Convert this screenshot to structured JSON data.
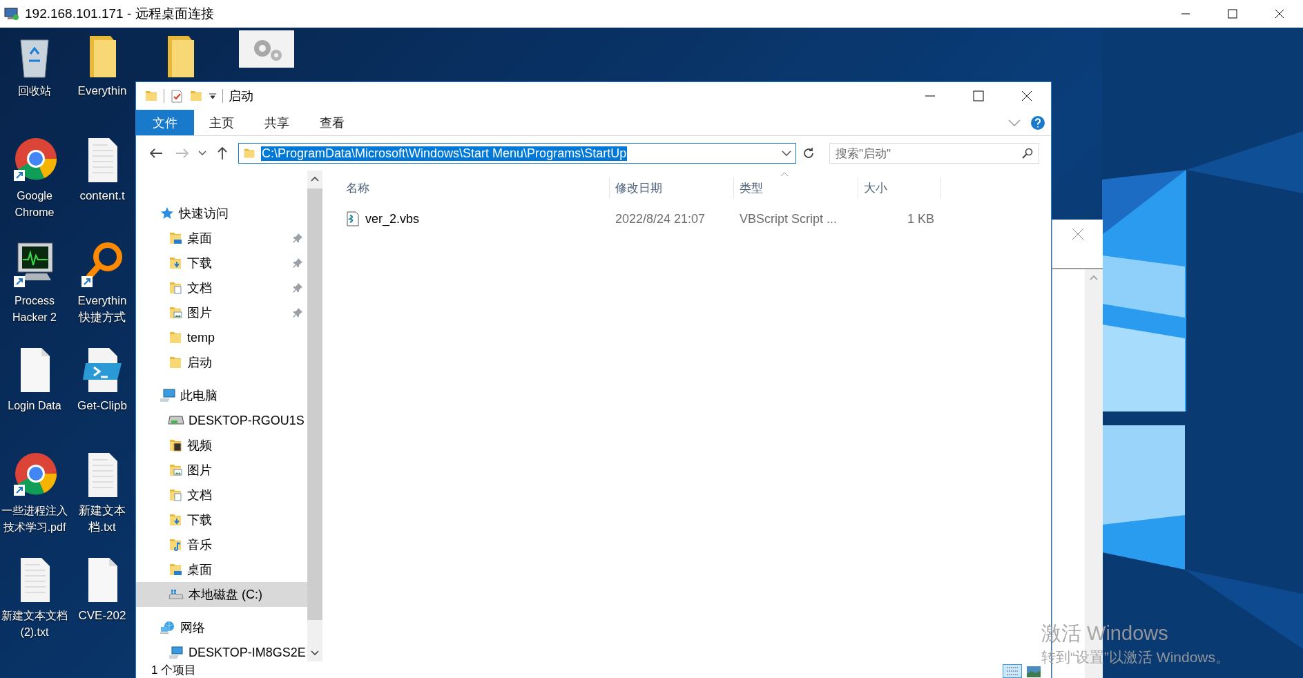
{
  "rdp_window": {
    "title": "192.168.101.171 - 远程桌面连接"
  },
  "desktop": {
    "columns": [
      [
        {
          "label": "回收站",
          "kind": "recycle-bin"
        },
        {
          "label": "Google Chrome",
          "kind": "browser"
        },
        {
          "label": "Process Hacker 2",
          "kind": "monitor"
        },
        {
          "label": "Login Data",
          "kind": "blank-file"
        },
        {
          "label": "一些进程注入技术学习.pdf",
          "kind": "browser"
        },
        {
          "label": "新建文本文档(2).txt",
          "kind": "text-file"
        }
      ],
      [
        {
          "lines": [
            "Everythin"
          ],
          "kind": "folder"
        },
        {
          "lines": [
            "content.t"
          ],
          "kind": "text-file"
        },
        {
          "lines": [
            "Everythin",
            "快捷方式"
          ],
          "kind": "magnifier"
        },
        {
          "lines": [
            "Get-Clipb"
          ],
          "kind": "script-file"
        },
        {
          "lines": [
            "新建文本",
            "档.txt"
          ],
          "kind": "text-file"
        },
        {
          "lines": [
            "CVE-202"
          ],
          "kind": "blank-file"
        }
      ],
      [
        {
          "kind": "folder"
        }
      ],
      [
        {
          "kind": "gears"
        }
      ]
    ]
  },
  "activation": {
    "title": "激活 Windows",
    "hint": "转到“设置”以激活 Windows。"
  },
  "explorer": {
    "title": "启动",
    "ribbon_tabs": [
      {
        "label": "文件",
        "selected": true
      },
      {
        "label": "主页",
        "selected": false
      },
      {
        "label": "共享",
        "selected": false
      },
      {
        "label": "查看",
        "selected": false
      }
    ],
    "address": "C:\\ProgramData\\Microsoft\\Windows\\Start Menu\\Programs\\StartUp",
    "search": {
      "placeholder": "搜索\"启动\""
    },
    "nav": [
      {
        "label": "快速访问",
        "kind": "quick-access",
        "selected": false,
        "children": [
          {
            "label": "桌面",
            "kind": "desktop",
            "pinned": true,
            "selected": false
          },
          {
            "label": "下载",
            "kind": "downloads",
            "pinned": true,
            "selected": false
          },
          {
            "label": "文档",
            "kind": "documents",
            "pinned": true,
            "selected": false
          },
          {
            "label": "图片",
            "kind": "pictures",
            "pinned": true,
            "selected": false
          },
          {
            "label": "temp",
            "kind": "folder",
            "pinned": false,
            "selected": false
          },
          {
            "label": "启动",
            "kind": "folder",
            "pinned": false,
            "selected": false
          }
        ]
      },
      {
        "label": "此电脑",
        "kind": "computer",
        "selected": false,
        "children": [
          {
            "label": "DESKTOP-RGOU1S",
            "kind": "network-drive",
            "pinned": false,
            "selected": false
          },
          {
            "label": "视频",
            "kind": "videos",
            "pinned": false,
            "selected": false
          },
          {
            "label": "图片",
            "kind": "pictures",
            "pinned": false,
            "selected": false
          },
          {
            "label": "文档",
            "kind": "documents",
            "pinned": false,
            "selected": false
          },
          {
            "label": "下载",
            "kind": "downloads",
            "pinned": false,
            "selected": false
          },
          {
            "label": "音乐",
            "kind": "music",
            "pinned": false,
            "selected": false
          },
          {
            "label": "桌面",
            "kind": "desktop",
            "pinned": false,
            "selected": false
          },
          {
            "label": "本地磁盘 (C:)",
            "kind": "drive",
            "pinned": false,
            "selected": true
          }
        ]
      },
      {
        "label": "网络",
        "kind": "network",
        "selected": false,
        "children": [
          {
            "label": "DESKTOP-IM8GS2E",
            "kind": "network-pc",
            "pinned": false,
            "selected": false
          }
        ]
      }
    ],
    "columns": [
      "名称",
      "修改日期",
      "类型",
      "大小"
    ],
    "files": [
      {
        "name": "ver_2.vbs",
        "modified": "2022/8/24 21:07",
        "type": "VBScript Script ...",
        "size": "1 KB",
        "selected": false
      }
    ],
    "status": "1 个项目"
  }
}
